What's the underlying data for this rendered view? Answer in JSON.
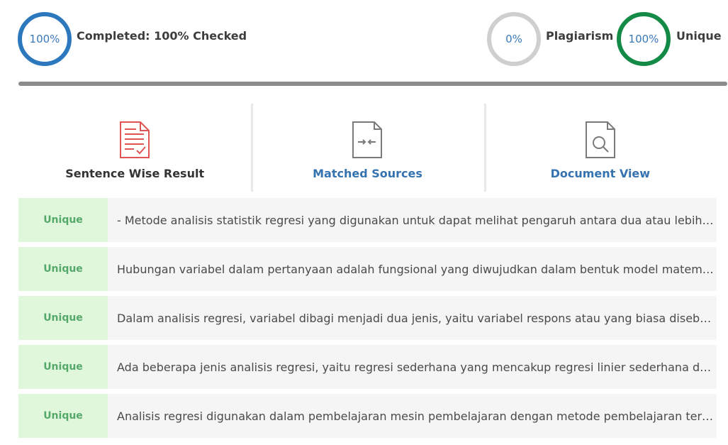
{
  "summary": {
    "completed": {
      "circle_text": "100%",
      "label": "Completed: 100% Checked",
      "percent": 100,
      "color": "#2d78bd"
    },
    "plagiarism": {
      "circle_text": "0%",
      "label": "Plagiarism",
      "percent": 0,
      "color": "#cfcfcf"
    },
    "unique": {
      "circle_text": "100%",
      "label": "Unique",
      "percent": 100,
      "color": "#138a45"
    },
    "progress_percent": 100
  },
  "tabs": [
    {
      "label": "Sentence Wise Result",
      "icon": "report-check-icon",
      "active": true,
      "color": "#e05454"
    },
    {
      "label": "Matched Sources",
      "icon": "compare-arrows-icon",
      "active": false,
      "color": "#3572b0"
    },
    {
      "label": "Document View",
      "icon": "document-search-icon",
      "active": false,
      "color": "#3572b0"
    }
  ],
  "results": [
    {
      "status": "Unique",
      "text": "- Metode analisis statistik regresi yang digunakan untuk dapat melihat pengaruh antara dua atau lebih…"
    },
    {
      "status": "Unique",
      "text": "Hubungan variabel dalam pertanyaan adalah fungsional yang diwujudkan dalam bentuk model matem…"
    },
    {
      "status": "Unique",
      "text": "Dalam analisis regresi, variabel dibagi menjadi dua jenis, yaitu variabel respons atau yang biasa disebu…"
    },
    {
      "status": "Unique",
      "text": "Ada beberapa jenis analisis regresi, yaitu regresi sederhana yang mencakup regresi linier sederhana d…"
    },
    {
      "status": "Unique",
      "text": "Analisis regresi digunakan dalam pembelajaran mesin pembelajaran dengan metode pembelajaran ter…"
    }
  ]
}
